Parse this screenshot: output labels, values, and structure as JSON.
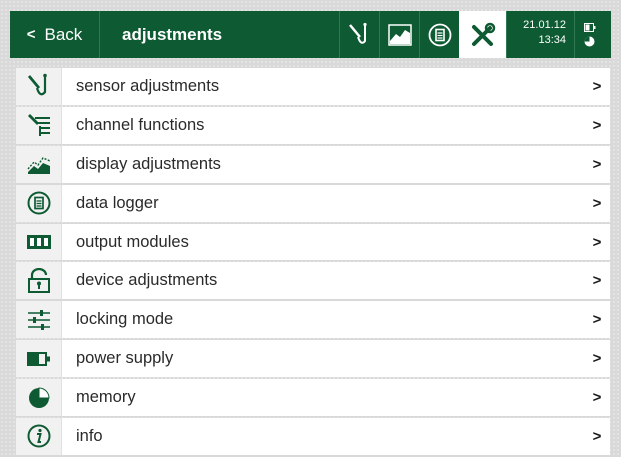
{
  "header": {
    "back_chevron": "<",
    "back_label": "Back",
    "title": "adjustments",
    "date": "21.01.12",
    "time": "13:34",
    "toolbar_icons": [
      "sensor-icon",
      "chart-icon",
      "logger-icon",
      "tools-icon"
    ]
  },
  "menu": {
    "items": [
      {
        "label": "sensor adjustments",
        "icon": "sensor-icon"
      },
      {
        "label": "channel functions",
        "icon": "channel-functions-icon"
      },
      {
        "label": "display adjustments",
        "icon": "chart-icon"
      },
      {
        "label": "data logger",
        "icon": "logger-icon"
      },
      {
        "label": "output modules",
        "icon": "output-modules-icon"
      },
      {
        "label": "device adjustments",
        "icon": "lock-open-icon"
      },
      {
        "label": "locking mode",
        "icon": "sliders-icon"
      },
      {
        "label": "power supply",
        "icon": "battery-icon"
      },
      {
        "label": "memory",
        "icon": "pie-icon"
      },
      {
        "label": "info",
        "icon": "info-icon"
      }
    ],
    "arrow": ">"
  },
  "colors": {
    "header_bg": "#0e5a32",
    "accent_green": "#0e5a32",
    "row_bg": "#ffffff"
  }
}
